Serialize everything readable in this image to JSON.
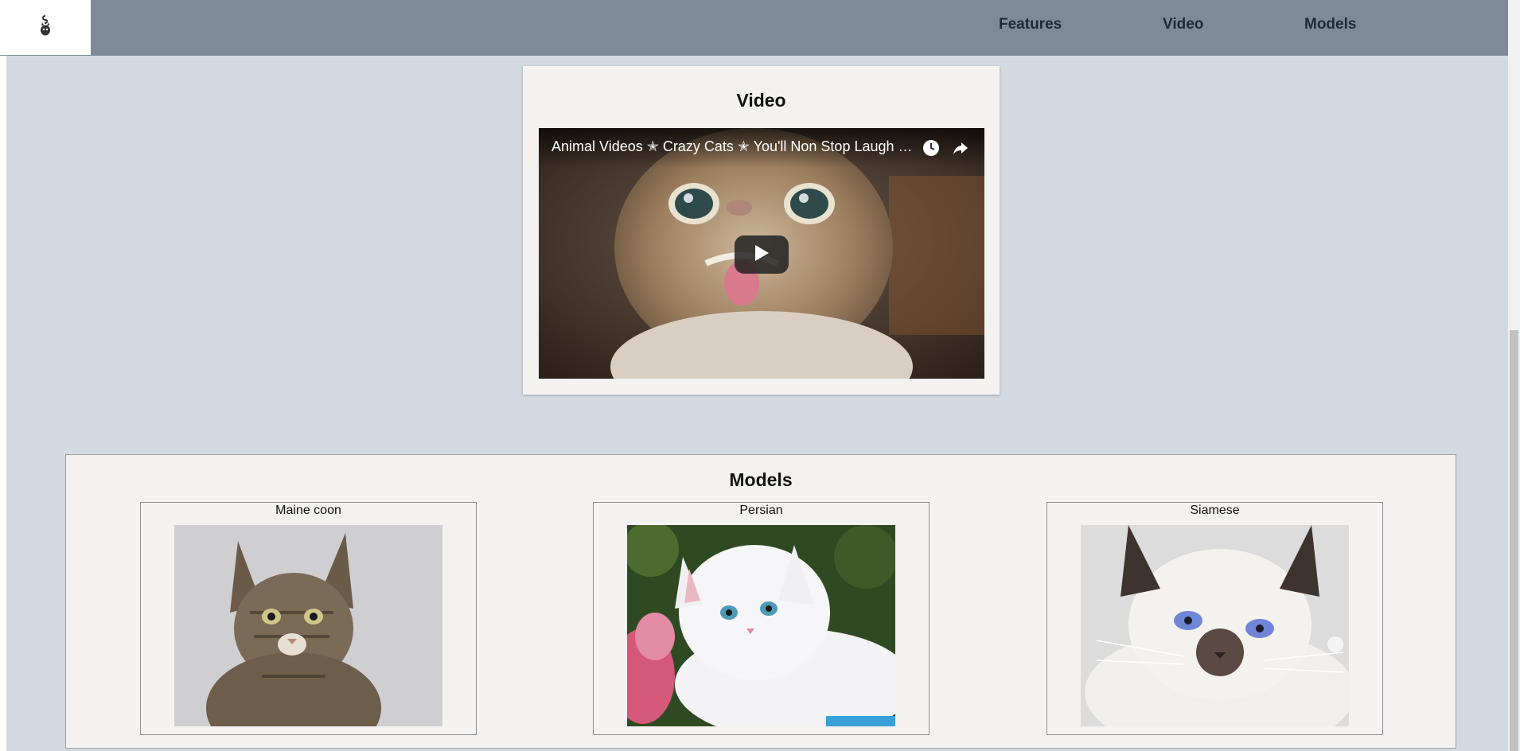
{
  "header": {
    "logo_icon": "cat-logo-icon",
    "nav": [
      {
        "label": "Features"
      },
      {
        "label": "Video"
      },
      {
        "label": "Models"
      }
    ]
  },
  "video_section": {
    "title": "Video",
    "player": {
      "caption": "Animal Videos ✭ Crazy Cats ✭ You'll Non Stop Laugh W...",
      "icons": [
        "clock-icon",
        "share-icon",
        "play-icon"
      ]
    }
  },
  "models_section": {
    "title": "Models",
    "items": [
      {
        "name": "Maine coon"
      },
      {
        "name": "Persian"
      },
      {
        "name": "Siamese"
      }
    ]
  },
  "colors": {
    "page_background": "#d2d9e1",
    "header_background": "#7d8a99",
    "card_background": "#f4f2f0",
    "nav_text": "#1f2a36"
  }
}
